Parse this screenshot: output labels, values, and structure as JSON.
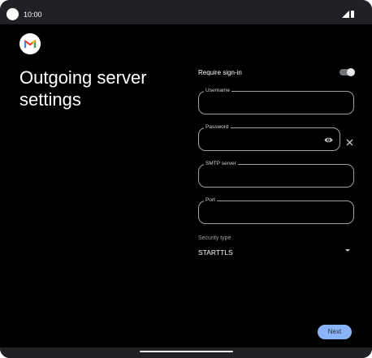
{
  "status_bar": {
    "time": "10:00",
    "icons": [
      "signal-icon",
      "battery-icon"
    ]
  },
  "app": {
    "logo_icon": "gmail-icon"
  },
  "page": {
    "title": "Outgoing server settings"
  },
  "form": {
    "require_signin_label": "Require sign-in",
    "require_signin_on": true,
    "username": {
      "label": "Username",
      "value": ""
    },
    "password": {
      "label": "Password",
      "value": ""
    },
    "smtp_server": {
      "label": "SMTP server",
      "value": ""
    },
    "port": {
      "label": "Port",
      "value": ""
    },
    "security_type": {
      "label": "Security type",
      "value": "STARTTLS"
    }
  },
  "buttons": {
    "next": "Next"
  },
  "colors": {
    "accent": "#8ab4f8",
    "background": "#000000",
    "statusbar": "#202124"
  }
}
